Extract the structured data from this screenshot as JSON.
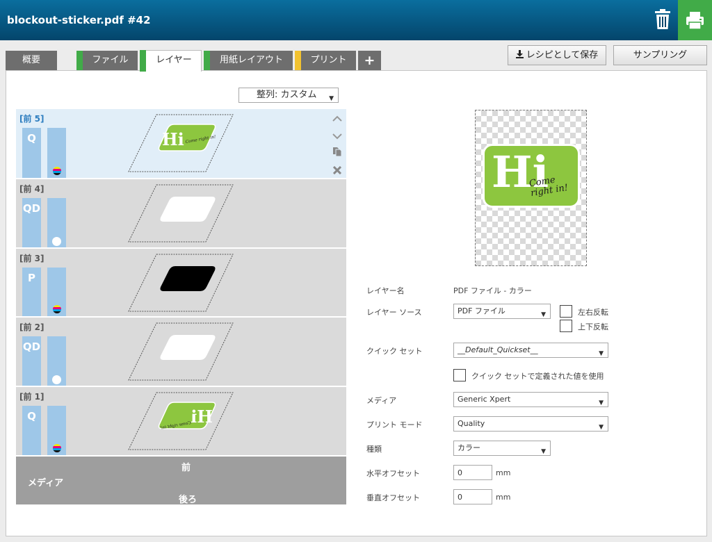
{
  "header": {
    "title": "blockout-sticker.pdf #42",
    "trash_icon": "trash-icon",
    "print_icon": "printer-icon",
    "print_bg": "#41ab48"
  },
  "tabs": [
    {
      "label": "概要",
      "marker": ""
    },
    {
      "label": "ファイル",
      "marker": "#41ab48"
    },
    {
      "label": "レイヤー",
      "marker": "#41ab48"
    },
    {
      "label": "用紙レイアウト",
      "marker": "#41ab48"
    },
    {
      "label": "プリント",
      "marker": "#f2c230"
    },
    {
      "label": "+",
      "marker": ""
    }
  ],
  "active_tab": "レイヤー",
  "toolbar": {
    "save_recipe_label": "レシピとして保存",
    "save_icon": "download-icon",
    "sampling_label": "サンプリング"
  },
  "layers_panel": {
    "sort_label": "整列: カスタム",
    "layers": [
      {
        "label": "[前 5]",
        "ink": "Q",
        "indicator": "cmyk",
        "selected": true,
        "shape": "hi-sticker"
      },
      {
        "label": "[前 4]",
        "ink": "QD",
        "indicator": "white",
        "selected": false,
        "shape": "white-shape"
      },
      {
        "label": "[前 3]",
        "ink": "P",
        "indicator": "cmyk",
        "selected": false,
        "shape": "black-shape"
      },
      {
        "label": "[前 2]",
        "ink": "QD",
        "indicator": "white",
        "selected": false,
        "shape": "white-shape"
      },
      {
        "label": "[前 1]",
        "ink": "Q",
        "indicator": "cmyk",
        "selected": false,
        "shape": "hi-sticker-mirrored"
      }
    ],
    "layer_tools": [
      "chevron-up-icon",
      "chevron-down-icon",
      "copy-icon",
      "close-icon"
    ],
    "media_bar": {
      "media_label": "メディア",
      "front_label": "前",
      "back_label": "後ろ"
    }
  },
  "preview": {
    "sticker_text": "Hi",
    "sticker_sub_1": "Come",
    "sticker_sub_2": "right in!",
    "sticker_color": "#8dc63f"
  },
  "form": {
    "layer_name_label": "レイヤー名",
    "layer_name_value": "PDF ファイル - カラー",
    "layer_source_label": "レイヤー ソース",
    "layer_source_value": "PDF ファイル",
    "flip_horizontal_label": "左右反転",
    "flip_vertical_label": "上下反転",
    "quickset_label": "クイック セット",
    "quickset_value": "__Default_Quickset__",
    "use_quickset_label": "クイック セットで定義された値を使用",
    "media_label": "メディア",
    "media_value": "Generic Xpert",
    "print_mode_label": "プリント モード",
    "print_mode_value": "Quality",
    "type_label": "種類",
    "type_value": "カラー",
    "h_offset_label": "水平オフセット",
    "h_offset_value": "0",
    "v_offset_label": "垂直オフセット",
    "v_offset_value": "0",
    "unit": "mm"
  }
}
